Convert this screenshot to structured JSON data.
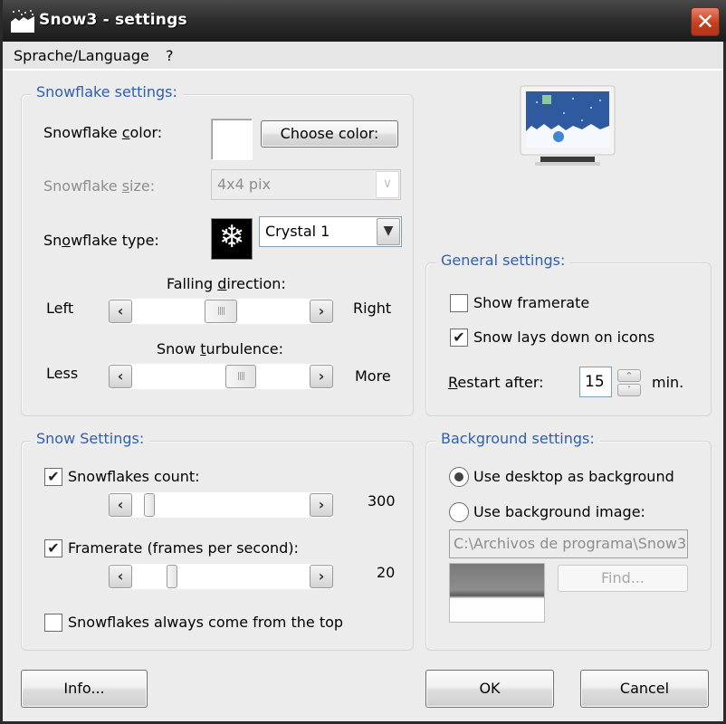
{
  "window": {
    "title": "Snow3 - settings",
    "close_label": "✕"
  },
  "menu": {
    "items": [
      {
        "label": "Sprache/Language"
      },
      {
        "label": "?"
      }
    ]
  },
  "snowflake_settings": {
    "legend": "Snowflake settings:",
    "color": {
      "label_pre": "Snowflake ",
      "label_ul": "c",
      "label_post": "olor:",
      "swatch_color": "#ffffff",
      "button_label": "Choose color:"
    },
    "size": {
      "label_pre": "Snowflake ",
      "label_ul": "s",
      "label_post": "ize:",
      "value": "4x4 pix",
      "disabled": true
    },
    "type": {
      "label_pre": "Sn",
      "label_ul": "o",
      "label_post": "wflake type:",
      "icon": "❄",
      "value": "Crystal 1"
    },
    "falling_direction": {
      "label_pre": "Falling ",
      "label_ul": "d",
      "label_post": "irection:",
      "min_label": "Left",
      "max_label": "Right",
      "position": 0.5
    },
    "turbulence": {
      "label_pre": "Snow ",
      "label_ul": "t",
      "label_post": "urbulence:",
      "min_label": "Less",
      "max_label": "More",
      "position": 0.64
    }
  },
  "general_settings": {
    "legend": "General settings:",
    "show_framerate": {
      "label": "Show framerate",
      "checked": false
    },
    "snow_on_icons": {
      "label": "Snow lays down on icons",
      "checked": true
    },
    "restart": {
      "label_ul": "R",
      "label_post": "estart after:",
      "value": "15",
      "unit": "min."
    }
  },
  "snow_settings": {
    "legend": "Snow Settings:",
    "count": {
      "label": "Snowflakes count:",
      "checked": true,
      "value": "300",
      "position": 0.06
    },
    "framerate": {
      "label": "Framerate (frames per second):",
      "checked": true,
      "value": "20",
      "position": 0.2
    },
    "from_top": {
      "label": "Snowflakes always come from the top",
      "checked": false
    }
  },
  "background_settings": {
    "legend": "Background settings:",
    "use_desktop": {
      "label": "Use desktop as background",
      "selected": true
    },
    "use_image": {
      "label": "Use background image:",
      "selected": false
    },
    "path": "C:\\Archivos de programa\\Snow3",
    "find_label": "Find..."
  },
  "footer": {
    "info_label": "Info...",
    "ok_label": "OK",
    "cancel_label": "Cancel"
  },
  "colors": {
    "legend_blue": "#2f5fad",
    "close_red": "#c4401f",
    "window_bg": "#ececec"
  }
}
